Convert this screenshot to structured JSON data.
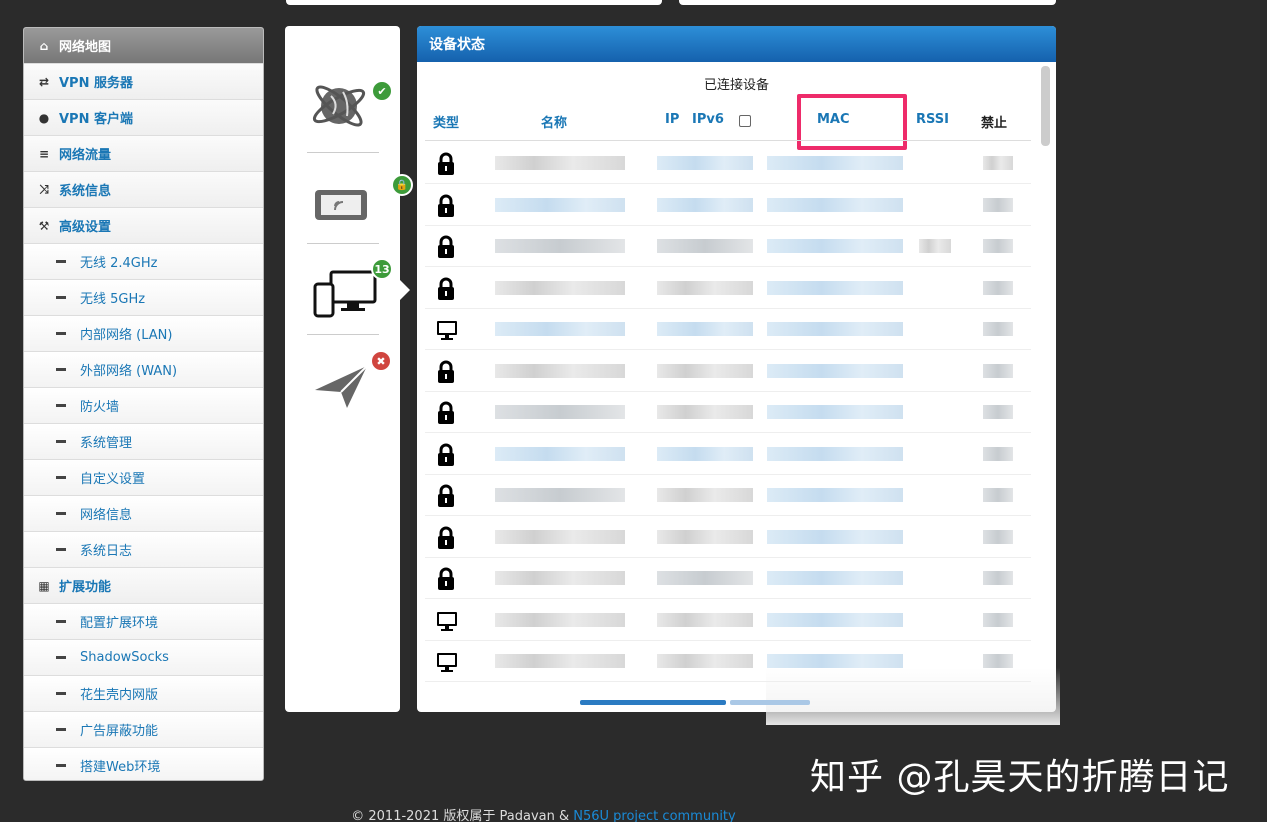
{
  "sidebar": {
    "items": [
      {
        "label": "网络地图",
        "icon": "home-icon",
        "level": "top",
        "active": true
      },
      {
        "label": "VPN 服务器",
        "icon": "loop-icon",
        "level": "top"
      },
      {
        "label": "VPN 客户端",
        "icon": "globe-icon",
        "level": "top"
      },
      {
        "label": "网络流量",
        "icon": "server-icon",
        "level": "top"
      },
      {
        "label": "系统信息",
        "icon": "shuffle-icon",
        "level": "top"
      },
      {
        "label": "高级设置",
        "icon": "wrench-icon",
        "level": "top"
      },
      {
        "label": "无线 2.4GHz",
        "level": "sub"
      },
      {
        "label": "无线 5GHz",
        "level": "sub"
      },
      {
        "label": "内部网络 (LAN)",
        "level": "sub"
      },
      {
        "label": "外部网络 (WAN)",
        "level": "sub"
      },
      {
        "label": "防火墙",
        "level": "sub"
      },
      {
        "label": "系统管理",
        "level": "sub"
      },
      {
        "label": "自定义设置",
        "level": "sub"
      },
      {
        "label": "网络信息",
        "level": "sub"
      },
      {
        "label": "系统日志",
        "level": "sub"
      },
      {
        "label": "扩展功能",
        "icon": "grid-icon",
        "level": "top"
      },
      {
        "label": "配置扩展环境",
        "level": "sub"
      },
      {
        "label": "ShadowSocks",
        "level": "sub"
      },
      {
        "label": "花生壳内网版",
        "level": "sub"
      },
      {
        "label": "广告屏蔽功能",
        "level": "sub"
      },
      {
        "label": "搭建Web环境",
        "level": "sub"
      }
    ]
  },
  "status_icons": {
    "internet": {
      "icon": "internet-globe-icon",
      "badge": "✔"
    },
    "wireless": {
      "icon": "wireless-device-icon",
      "badge": "🔒"
    },
    "clients": {
      "icon": "clients-devices-icon",
      "badge": "13"
    },
    "vpn": {
      "icon": "paper-plane-icon",
      "badge": "✖"
    }
  },
  "panel": {
    "title": "设备状态",
    "subtitle": "已连接设备",
    "columns": {
      "type": "类型",
      "name": "名称",
      "ip": "IP",
      "ipv6": "IPv6",
      "mac": "MAC",
      "rssi": "RSSI",
      "block": "禁止"
    },
    "rows": [
      {
        "type": "lock"
      },
      {
        "type": "lock"
      },
      {
        "type": "lock"
      },
      {
        "type": "lock"
      },
      {
        "type": "monitor"
      },
      {
        "type": "lock"
      },
      {
        "type": "lock"
      },
      {
        "type": "lock"
      },
      {
        "type": "lock"
      },
      {
        "type": "lock"
      },
      {
        "type": "lock"
      },
      {
        "type": "monitor"
      },
      {
        "type": "monitor"
      }
    ]
  },
  "watermark": "知乎 @孔昊天的折腾日记",
  "footer": {
    "text": "© 2011-2021 版权属于 Padavan & ",
    "link": "N56U project community"
  },
  "colors": {
    "accent": "#1a77b5",
    "header": "#1f74c0",
    "highlight": "#ee2b6a",
    "ok": "#3d9b3a",
    "error": "#d0453f"
  }
}
